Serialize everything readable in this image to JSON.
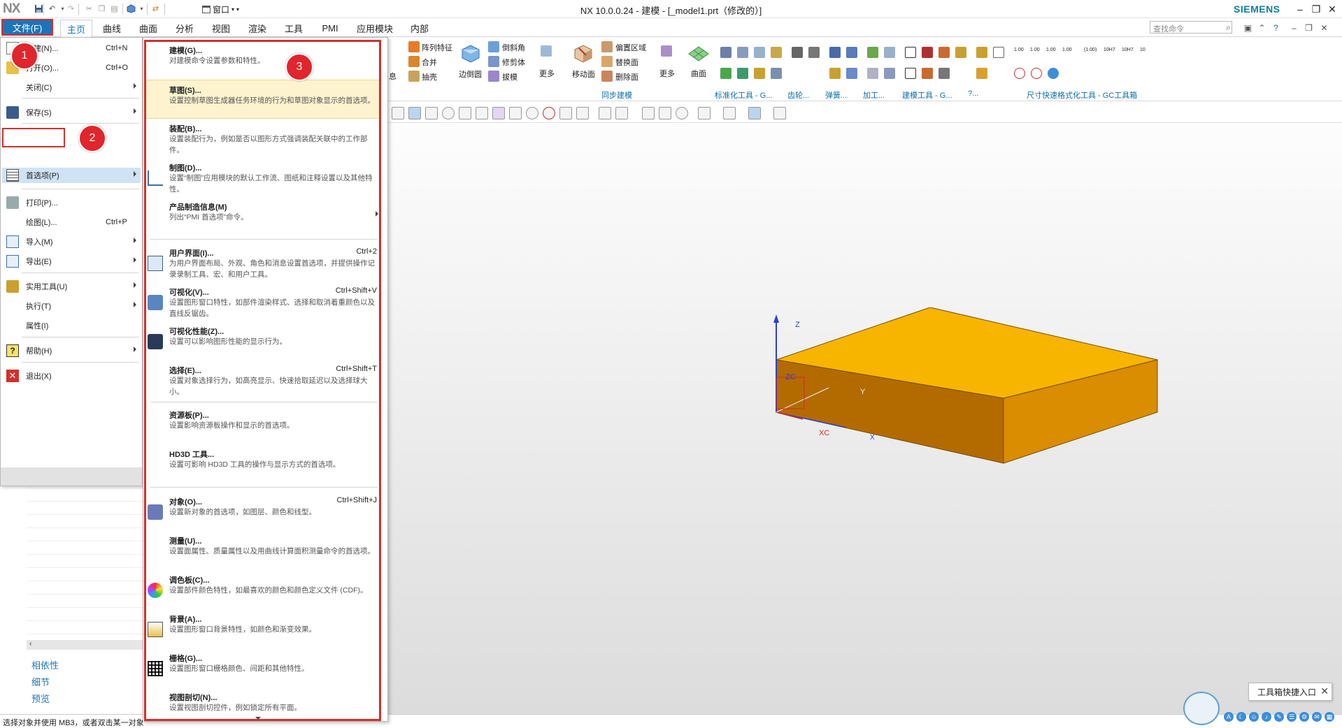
{
  "titlebar": {
    "logo": "NX",
    "window_menu_label": "窗口",
    "title": "NX 10.0.0.24 - 建模 - [_model1.prt（修改的）]",
    "vendor": "SIEMENS"
  },
  "tabs": {
    "file": "文件(F)",
    "items": [
      "主页",
      "曲线",
      "曲面",
      "分析",
      "视图",
      "渲染",
      "工具",
      "PMI",
      "应用模块",
      "内部"
    ],
    "active": "主页",
    "search_placeholder": "查找命令"
  },
  "ribbon": {
    "commands": {
      "pattern_feature": "阵列特征",
      "unite": "合并",
      "shell": "抽壳",
      "info_partial": "息",
      "edge_blend": "边倒圆",
      "chamfer": "倒斜角",
      "trim_body": "修剪体",
      "draft": "拔模",
      "more1": "更多",
      "move_face": "移动面",
      "offset_region": "偏置区域",
      "replace_face": "替换面",
      "delete_face": "删除面",
      "more2": "更多",
      "surface": "曲面"
    },
    "groups": {
      "sync_modeling": "同步建模",
      "standard_tools": "标准化工具 - G...",
      "gear": "齿轮...",
      "spring": "弹簧...",
      "machining": "加工...",
      "modeling_tools": "建模工具 - G...",
      "dim_format": "尺寸快速格式化工具 - GC工具箱",
      "other": "?..."
    },
    "tolerance_labels": [
      "1.00",
      "1.00",
      "1.00",
      "1.00",
      "(1.00)",
      "10H7",
      "10H7",
      "10"
    ]
  },
  "viewport": {
    "axis_labels": {
      "z": "Z",
      "zc": "ZC",
      "y": "Y",
      "xc": "XC",
      "x": "X"
    }
  },
  "navigator": {
    "links": [
      "相依性",
      "细节",
      "预览"
    ]
  },
  "status": {
    "text": "选择对象并使用 MB3，或者双击某一对象"
  },
  "file_menu": {
    "items": [
      {
        "label": "新建(N)...",
        "shortcut": "Ctrl+N"
      },
      {
        "label": "打开(O)...",
        "shortcut": "Ctrl+O"
      },
      {
        "label": "关闭(C)"
      },
      {
        "label": "保存(S)"
      },
      {
        "label": "首选项(P)"
      },
      {
        "label": "打印(P)..."
      },
      {
        "label": "绘图(L)...",
        "shortcut": "Ctrl+P"
      },
      {
        "label": "导入(M)"
      },
      {
        "label": "导出(E)"
      },
      {
        "label": "实用工具(U)"
      },
      {
        "label": "执行(T)"
      },
      {
        "label": "属性(I)"
      },
      {
        "label": "帮助(H)"
      },
      {
        "label": "退出(X)"
      }
    ]
  },
  "badges": [
    "1",
    "2",
    "3"
  ],
  "pref_menu": {
    "items": [
      {
        "title": "建模(G)...",
        "desc": "对建模命令设置参数和特性。"
      },
      {
        "title": "草图(S)...",
        "desc": "设置控制草图生成器任务环境的行为和草图对象显示的首选项。"
      },
      {
        "title": "装配(B)...",
        "desc": "设置装配行为，例如是否以图形方式强调装配关联中的工作部件。"
      },
      {
        "title": "制图(D)...",
        "desc": "设置“制图”应用模块的默认工作流、图纸和注释设置以及其他特性。"
      },
      {
        "title": "产品制造信息(M)",
        "desc": "列出“PMI 首选项”命令。"
      },
      {
        "title": "用户界面(I)...",
        "shortcut": "Ctrl+2",
        "desc": "为用户界面布局、外观、角色和消息设置首选项，并提供操作记录录制工具、宏、和用户工具。"
      },
      {
        "title": "可视化(V)...",
        "shortcut": "Ctrl+Shift+V",
        "desc": "设置图形窗口特性，如部件渲染样式、选择和取消着重颜色以及直线反锯齿。"
      },
      {
        "title": "可视化性能(Z)...",
        "desc": "设置可以影响图形性能的显示行为。"
      },
      {
        "title": "选择(E)...",
        "shortcut": "Ctrl+Shift+T",
        "desc": "设置对象选择行为，如高亮显示、快速拾取延迟以及选择球大小。"
      },
      {
        "title": "资源板(P)...",
        "desc": "设置影响资源板操作和显示的首选项。"
      },
      {
        "title": "HD3D 工具...",
        "desc": "设置可影响 HD3D 工具的操作与显示方式的首选项。"
      },
      {
        "title": "对象(O)...",
        "shortcut": "Ctrl+Shift+J",
        "desc": "设置新对象的首选项，如图层、颜色和线型。"
      },
      {
        "title": "测量(U)...",
        "desc": "设置面属性、质量属性以及用曲线计算面积测量命令的首选项。"
      },
      {
        "title": "调色板(C)...",
        "desc": "设置部件颜色特性，如最喜欢的颜色和颜色定义文件 (CDF)。"
      },
      {
        "title": "背景(A)...",
        "desc": "设置图形窗口背景特性，如颜色和渐变效果。"
      },
      {
        "title": "栅格(G)...",
        "desc": "设置图形窗口栅格颜色、间距和其他特性。"
      },
      {
        "title": "视图剖切(N)...",
        "desc": "设置视图剖切控件，例如锁定所有平面。"
      }
    ]
  },
  "tooltip": {
    "text": "工具箱快捷入口"
  },
  "colors": {
    "accent": "#1d74b8",
    "highlight_border": "#d0312d",
    "badge": "#e0262c",
    "model_top": "#f7b500",
    "model_side": "#d98d00",
    "model_front": "#b36b00"
  }
}
